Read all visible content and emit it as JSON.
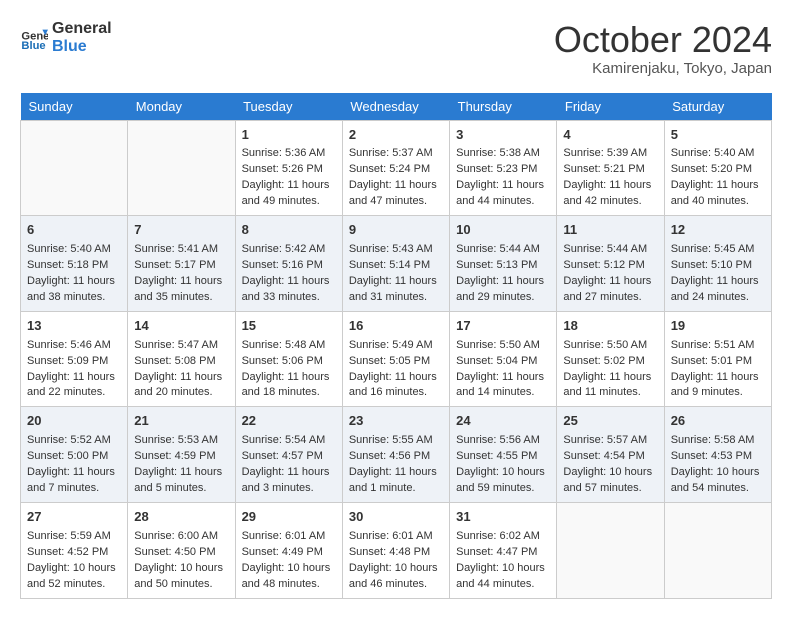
{
  "header": {
    "logo_line1": "General",
    "logo_line2": "Blue",
    "month": "October 2024",
    "location": "Kamirenjaku, Tokyo, Japan"
  },
  "days_of_week": [
    "Sunday",
    "Monday",
    "Tuesday",
    "Wednesday",
    "Thursday",
    "Friday",
    "Saturday"
  ],
  "weeks": [
    [
      {
        "day": "",
        "content": ""
      },
      {
        "day": "",
        "content": ""
      },
      {
        "day": "1",
        "content": "Sunrise: 5:36 AM\nSunset: 5:26 PM\nDaylight: 11 hours and 49 minutes."
      },
      {
        "day": "2",
        "content": "Sunrise: 5:37 AM\nSunset: 5:24 PM\nDaylight: 11 hours and 47 minutes."
      },
      {
        "day": "3",
        "content": "Sunrise: 5:38 AM\nSunset: 5:23 PM\nDaylight: 11 hours and 44 minutes."
      },
      {
        "day": "4",
        "content": "Sunrise: 5:39 AM\nSunset: 5:21 PM\nDaylight: 11 hours and 42 minutes."
      },
      {
        "day": "5",
        "content": "Sunrise: 5:40 AM\nSunset: 5:20 PM\nDaylight: 11 hours and 40 minutes."
      }
    ],
    [
      {
        "day": "6",
        "content": "Sunrise: 5:40 AM\nSunset: 5:18 PM\nDaylight: 11 hours and 38 minutes."
      },
      {
        "day": "7",
        "content": "Sunrise: 5:41 AM\nSunset: 5:17 PM\nDaylight: 11 hours and 35 minutes."
      },
      {
        "day": "8",
        "content": "Sunrise: 5:42 AM\nSunset: 5:16 PM\nDaylight: 11 hours and 33 minutes."
      },
      {
        "day": "9",
        "content": "Sunrise: 5:43 AM\nSunset: 5:14 PM\nDaylight: 11 hours and 31 minutes."
      },
      {
        "day": "10",
        "content": "Sunrise: 5:44 AM\nSunset: 5:13 PM\nDaylight: 11 hours and 29 minutes."
      },
      {
        "day": "11",
        "content": "Sunrise: 5:44 AM\nSunset: 5:12 PM\nDaylight: 11 hours and 27 minutes."
      },
      {
        "day": "12",
        "content": "Sunrise: 5:45 AM\nSunset: 5:10 PM\nDaylight: 11 hours and 24 minutes."
      }
    ],
    [
      {
        "day": "13",
        "content": "Sunrise: 5:46 AM\nSunset: 5:09 PM\nDaylight: 11 hours and 22 minutes."
      },
      {
        "day": "14",
        "content": "Sunrise: 5:47 AM\nSunset: 5:08 PM\nDaylight: 11 hours and 20 minutes."
      },
      {
        "day": "15",
        "content": "Sunrise: 5:48 AM\nSunset: 5:06 PM\nDaylight: 11 hours and 18 minutes."
      },
      {
        "day": "16",
        "content": "Sunrise: 5:49 AM\nSunset: 5:05 PM\nDaylight: 11 hours and 16 minutes."
      },
      {
        "day": "17",
        "content": "Sunrise: 5:50 AM\nSunset: 5:04 PM\nDaylight: 11 hours and 14 minutes."
      },
      {
        "day": "18",
        "content": "Sunrise: 5:50 AM\nSunset: 5:02 PM\nDaylight: 11 hours and 11 minutes."
      },
      {
        "day": "19",
        "content": "Sunrise: 5:51 AM\nSunset: 5:01 PM\nDaylight: 11 hours and 9 minutes."
      }
    ],
    [
      {
        "day": "20",
        "content": "Sunrise: 5:52 AM\nSunset: 5:00 PM\nDaylight: 11 hours and 7 minutes."
      },
      {
        "day": "21",
        "content": "Sunrise: 5:53 AM\nSunset: 4:59 PM\nDaylight: 11 hours and 5 minutes."
      },
      {
        "day": "22",
        "content": "Sunrise: 5:54 AM\nSunset: 4:57 PM\nDaylight: 11 hours and 3 minutes."
      },
      {
        "day": "23",
        "content": "Sunrise: 5:55 AM\nSunset: 4:56 PM\nDaylight: 11 hours and 1 minute."
      },
      {
        "day": "24",
        "content": "Sunrise: 5:56 AM\nSunset: 4:55 PM\nDaylight: 10 hours and 59 minutes."
      },
      {
        "day": "25",
        "content": "Sunrise: 5:57 AM\nSunset: 4:54 PM\nDaylight: 10 hours and 57 minutes."
      },
      {
        "day": "26",
        "content": "Sunrise: 5:58 AM\nSunset: 4:53 PM\nDaylight: 10 hours and 54 minutes."
      }
    ],
    [
      {
        "day": "27",
        "content": "Sunrise: 5:59 AM\nSunset: 4:52 PM\nDaylight: 10 hours and 52 minutes."
      },
      {
        "day": "28",
        "content": "Sunrise: 6:00 AM\nSunset: 4:50 PM\nDaylight: 10 hours and 50 minutes."
      },
      {
        "day": "29",
        "content": "Sunrise: 6:01 AM\nSunset: 4:49 PM\nDaylight: 10 hours and 48 minutes."
      },
      {
        "day": "30",
        "content": "Sunrise: 6:01 AM\nSunset: 4:48 PM\nDaylight: 10 hours and 46 minutes."
      },
      {
        "day": "31",
        "content": "Sunrise: 6:02 AM\nSunset: 4:47 PM\nDaylight: 10 hours and 44 minutes."
      },
      {
        "day": "",
        "content": ""
      },
      {
        "day": "",
        "content": ""
      }
    ]
  ]
}
